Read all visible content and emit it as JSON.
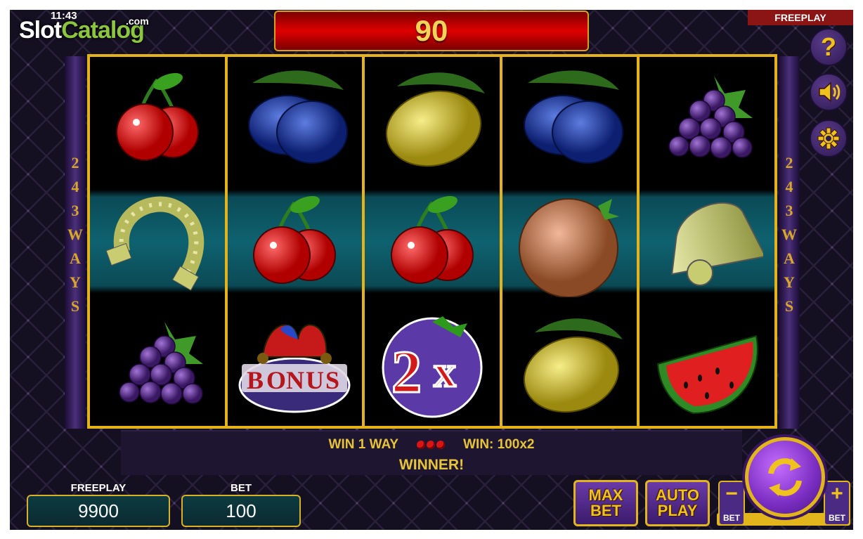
{
  "status_bar": {
    "time": "11:43"
  },
  "watermark": {
    "part1": "Slot",
    "part2": "Catalog",
    "suffix": ".com"
  },
  "top_display": {
    "value": "90"
  },
  "mode_tag": "FREEPLAY",
  "side_controls": [
    {
      "id": "help",
      "icon": "question-icon",
      "glyph": "?"
    },
    {
      "id": "sound",
      "icon": "speaker-icon"
    },
    {
      "id": "settings",
      "icon": "gear-icon"
    }
  ],
  "ways_label": [
    "2",
    "4",
    "3",
    "W",
    "A",
    "Y",
    "S"
  ],
  "reels": [
    [
      "cherry",
      "horseshoe",
      "grapes"
    ],
    [
      "plum",
      "cherry",
      "bonus"
    ],
    [
      "lemon",
      "cherry",
      "2x"
    ],
    [
      "plum",
      "orange",
      "lemon"
    ],
    [
      "grapes",
      "bell",
      "watermelon"
    ]
  ],
  "win_info": {
    "ways_text": "WIN 1 WAY",
    "win_text": "WIN: 100x2",
    "winner_text": "WINNER!"
  },
  "balance": {
    "label": "FREEPLAY",
    "value": "9900"
  },
  "bet": {
    "label": "BET",
    "value": "100"
  },
  "buttons": {
    "max_bet": [
      "MAX",
      "BET"
    ],
    "auto_play": [
      "AUTO",
      "PLAY"
    ],
    "bet_minus": {
      "sign": "−",
      "label": "BET"
    },
    "bet_plus": {
      "sign": "+",
      "label": "BET"
    }
  },
  "colors": {
    "gold": "#e4b21b",
    "red_display": "#e00000",
    "purple": "#6a3aa8",
    "teal": "#0e6270"
  }
}
